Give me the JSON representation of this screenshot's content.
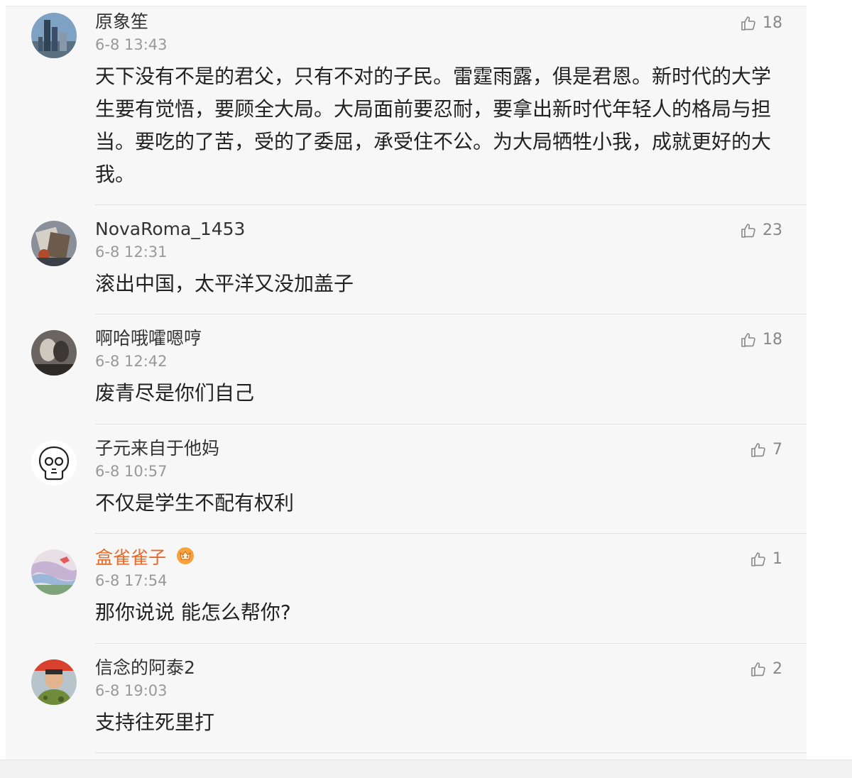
{
  "comments": [
    {
      "username": "原象笙",
      "time": "6-8 13:43",
      "likes": "18",
      "content": "天下没有不是的君父，只有不对的子民。雷霆雨露，俱是君恩。新时代的大学生要有觉悟，要顾全大局。大局面前要忍耐，要拿出新时代年轻人的格局与担当。要吃的了苦，受的了委屈，承受住不公。为大局牺牲小我，成就更好的大我。"
    },
    {
      "username": "NovaRoma_1453",
      "time": "6-8 12:31",
      "likes": "23",
      "content": "滚出中国，太平洋又没加盖子"
    },
    {
      "username": "啊哈哦嚯嗯哼",
      "time": "6-8 12:42",
      "likes": "18",
      "content": "废青尽是你们自己"
    },
    {
      "username": "子元来自于他妈",
      "time": "6-8 10:57",
      "likes": "7",
      "content": "不仅是学生不配有权利"
    },
    {
      "username": "盒雀雀子",
      "time": "6-8 17:54",
      "likes": "1",
      "content": "那你说说 能怎么帮你?"
    },
    {
      "username": "信念的阿泰2",
      "time": "6-8 19:03",
      "likes": "2",
      "content": "支持往死里打"
    }
  ],
  "colors": {
    "background": "#f7f7f7",
    "username": "#333333",
    "username_highlight": "#e8692a",
    "time": "#999999",
    "content": "#222222",
    "like": "#888888"
  },
  "icons": {
    "like": "thumbs-up-icon",
    "vip": "vip-badge-icon"
  }
}
